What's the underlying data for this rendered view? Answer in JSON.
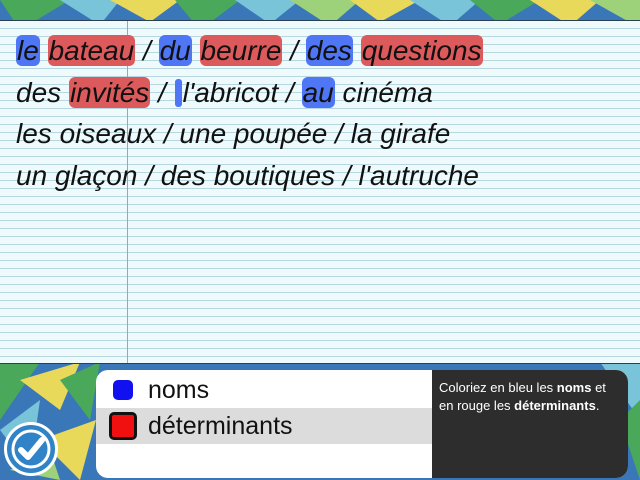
{
  "exercise": {
    "lines": [
      [
        {
          "text": "le",
          "mark": "blue"
        },
        {
          "text": " ",
          "mark": ""
        },
        {
          "text": "bateau",
          "mark": "red"
        },
        {
          "text": " / ",
          "mark": ""
        },
        {
          "text": "du",
          "mark": "blue"
        },
        {
          "text": " ",
          "mark": ""
        },
        {
          "text": "beurre",
          "mark": "red"
        },
        {
          "text": " / ",
          "mark": ""
        },
        {
          "text": "des",
          "mark": "blue"
        },
        {
          "text": " ",
          "mark": ""
        },
        {
          "text": "questions",
          "mark": "red"
        }
      ],
      [
        {
          "text": "des ",
          "mark": ""
        },
        {
          "text": "invités",
          "mark": "red"
        },
        {
          "text": " / ",
          "mark": ""
        },
        {
          "text": "",
          "mark": "cursor"
        },
        {
          "text": "l'abricot / ",
          "mark": ""
        },
        {
          "text": "au",
          "mark": "blue"
        },
        {
          "text": " cinéma",
          "mark": ""
        }
      ],
      [
        {
          "text": "les oiseaux / une poupée / la girafe",
          "mark": ""
        }
      ],
      [
        {
          "text": "un glaçon / des boutiques / l'autruche",
          "mark": ""
        }
      ]
    ]
  },
  "legend": {
    "nouns_label": "noms",
    "determiners_label": "déterminants"
  },
  "instructions": {
    "part1": "Coloriez en bleu les ",
    "bold1": "noms",
    "part2": " et en rouge les ",
    "bold2": "déterminants",
    "part3": "."
  },
  "colors": {
    "nouns": "#1010f0",
    "determiners": "#f01010",
    "highlight_blue": "#4f76f5",
    "highlight_red": "#dc5a5c"
  },
  "icons": {
    "check_button": "checkmark-icon"
  }
}
